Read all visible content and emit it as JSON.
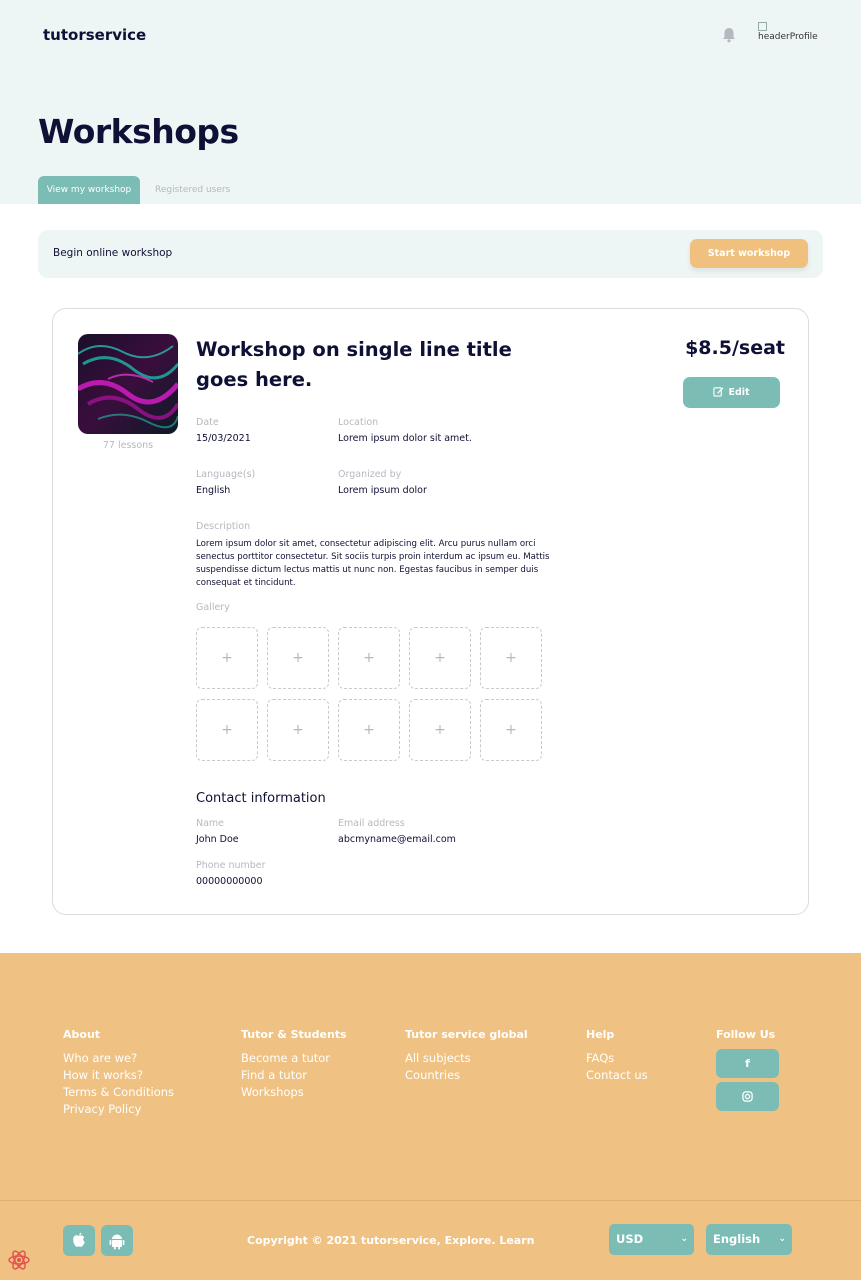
{
  "header": {
    "brand": "tutorservice",
    "profile_alt": "headerProfile",
    "page_title": "Workshops",
    "tabs": [
      {
        "label": "View my workshop",
        "active": true
      },
      {
        "label": "Registered users",
        "active": false
      }
    ]
  },
  "begin_bar": {
    "text": "Begin online workshop",
    "button": "Start workshop"
  },
  "workshop": {
    "lessons": "77 lessons",
    "title": "Workshop on single line title goes here.",
    "price": "$8.5/seat",
    "edit_label": "Edit",
    "date_label": "Date",
    "date": "15/03/2021",
    "location_label": "Location",
    "location": "Lorem ipsum dolor sit amet.",
    "language_label": "Language(s)",
    "language": "English",
    "organizer_label": "Organized by",
    "organizer": "Lorem ipsum dolor",
    "description_label": "Description",
    "description": "Lorem ipsum dolor sit amet, consectetur adipiscing elit. Arcu purus nullam orci senectus porttitor consectetur. Sit sociis turpis proin interdum ac ipsum eu. Mattis suspendisse dictum lectus mattis ut nunc non. Egestas faucibus in semper duis consequat et tincidunt.",
    "gallery_label": "Gallery",
    "gallery_slot_symbol": "+"
  },
  "contact": {
    "heading": "Contact information",
    "name_label": "Name",
    "name": "John Doe",
    "email_label": "Email address",
    "email": "abcmyname@email.com",
    "phone_label": "Phone number",
    "phone": "00000000000"
  },
  "footer": {
    "columns": [
      {
        "heading": "About",
        "links": [
          "Who are we?",
          "How it works?",
          "Terms & Conditions",
          "Privacy Policy"
        ]
      },
      {
        "heading": "Tutor & Students",
        "links": [
          "Become a tutor",
          "Find a tutor",
          "Workshops"
        ]
      },
      {
        "heading": "Tutor service global",
        "links": [
          "All subjects",
          "Countries"
        ]
      },
      {
        "heading": "Help",
        "links": [
          "FAQs",
          "Contact us"
        ]
      }
    ],
    "follow_heading": "Follow Us",
    "social": [
      {
        "icon": "facebook-icon",
        "glyph": "f"
      },
      {
        "icon": "instagram-icon",
        "glyph": "◘"
      }
    ],
    "copyright": "Copyright © 2021 tutorservice, Explore. Learn",
    "currency": "USD",
    "language": "English"
  },
  "colors": {
    "navy": "#0f1035",
    "teal": "#7bbcb5",
    "orange": "#f0c07f",
    "hero_bg": "#eef6f5"
  }
}
